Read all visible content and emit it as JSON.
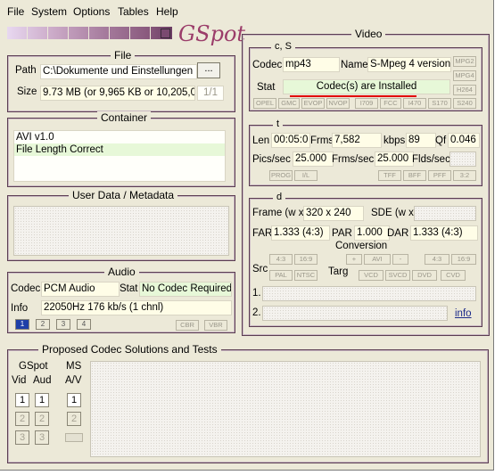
{
  "menu": [
    "File",
    "System",
    "Options",
    "Tables",
    "Help"
  ],
  "logo": "GSpot",
  "file": {
    "legend": "File",
    "path_label": "Path",
    "path_value": "C:\\Dokumente und Einstellungen",
    "browse_label": "...",
    "size_label": "Size",
    "size_value": "9.73 MB (or 9,965 KB or 10,205,0",
    "pager": "1/1"
  },
  "container": {
    "legend": "Container",
    "items": [
      "AVI v1.0",
      "File Length Correct"
    ]
  },
  "userdata": {
    "legend": "User Data / Metadata"
  },
  "audio": {
    "legend": "Audio",
    "codec_label": "Codec",
    "codec_value": "PCM Audio",
    "stat_label": "Stat",
    "stat_value": "No Codec Required",
    "info_label": "Info",
    "info_value": "22050Hz  176 kb/s (1 chnl)",
    "tabs": [
      "1",
      "2",
      "3",
      "4"
    ],
    "cbr": "CBR",
    "vbr": "VBR"
  },
  "video": {
    "legend": "Video",
    "cs": {
      "legend": "c, S",
      "codec_label": "Codec",
      "codec_value": "mp43",
      "name_label": "Name",
      "name_value": "S-Mpeg 4 version",
      "stat_label": "Stat",
      "stat_value": "Codec(s) are Installed",
      "side": [
        "MPG2",
        "MPG4",
        "H264"
      ],
      "row": [
        "OPEL",
        "GMC",
        "EVOP",
        "NVOP",
        "I709",
        "FCC",
        "I470",
        "S170",
        "S240"
      ]
    },
    "t": {
      "legend": "t",
      "len_label": "Len",
      "len_value": "00:05:0",
      "frms_label": "Frms",
      "frms_value": "7,582",
      "kbps_label": "kbps",
      "kbps_value": "89",
      "qf_label": "Qf",
      "qf_value": "0.046",
      "pics_label": "Pics/sec",
      "pics_value": "25.000",
      "frms_sec_label": "Frms/sec",
      "frms_sec_value": "25.000",
      "flds_label": "Flds/sec",
      "btns": [
        "PROG",
        "I/L",
        "TFF",
        "BFF",
        "PFF",
        "3:2"
      ]
    },
    "d": {
      "legend": "d",
      "frame_label": "Frame (w x",
      "frame_value": "320 x 240",
      "sde_label": "SDE (w x",
      "far_label": "FAR",
      "far_value": "1.333 (4:3)",
      "par_label": "PAR",
      "par_value": "1.000",
      "dar_label": "DAR",
      "dar_value": "1.333 (4:3)",
      "conversion": "Conversion",
      "src_label": "Src",
      "targ_label": "Targ",
      "src_btns": [
        "4:3",
        "16:9",
        "PAL",
        "NTSC"
      ],
      "targ_btns": [
        "+",
        "AVI",
        "-",
        "4:3",
        "16:9",
        "VCD",
        "SVCD",
        "DVD",
        "CVD"
      ],
      "line1": "1.",
      "line2": "2.",
      "info_link": "info"
    }
  },
  "proposed": {
    "legend": "Proposed Codec Solutions and Tests",
    "gspot": "GSpot",
    "ms": "MS",
    "vid": "Vid",
    "aud": "Aud",
    "av": "A/V",
    "nums": [
      "1",
      "2",
      "3"
    ]
  },
  "colors": {
    "border": "#5b3d52",
    "accent_red": "#e20000",
    "logo": "#9b3d6a",
    "green_field": "#e7f8d8"
  }
}
